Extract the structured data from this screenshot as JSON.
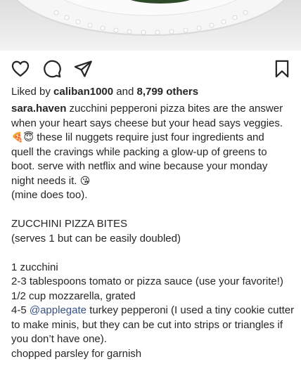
{
  "post": {
    "likes": {
      "prefix": "Liked by",
      "user": "caliban1000",
      "middle": "and",
      "count": "8,799 others"
    },
    "author": "sara.haven",
    "caption_lines": [
      {
        "before": " zucchini pepperoni pizza bites are the answer"
      },
      {
        "before": "when your heart says cheese but your head says veggies."
      },
      {
        "emoji": "🍕😇",
        "before": " these lil nuggets require just four ingredients and"
      },
      {
        "before": "quell the cravings while packing a glow-up of greens to"
      },
      {
        "before": "boot. serve with netflix and wine because your monday"
      },
      {
        "before": "night needs it. ",
        "emoji_after": "😘"
      },
      {
        "before": "(mine does too)."
      },
      {
        "before": ""
      },
      {
        "before": "ZUCCHINI PIZZA BITES"
      },
      {
        "before": "(serves 1 but can be easily doubled)"
      },
      {
        "before": ""
      },
      {
        "before": "1 zucchini"
      },
      {
        "before": "2-3 tablespoons tomato or pizza sauce (use your favorite!)"
      },
      {
        "before": "1/2 cup mozzarella, grated"
      },
      {
        "before": "4-5 ",
        "mention": "@applegate",
        "after": " turkey pepperoni (I used a tiny cookie cutter"
      },
      {
        "before": "to make minis, but they can be cut into strips or triangles if"
      },
      {
        "before": "you don’t have one)."
      },
      {
        "before": "chopped parsley for garnish"
      }
    ]
  },
  "icons": {
    "like": "heart-icon",
    "comment": "comment-bubble-icon",
    "share": "paper-plane-icon",
    "save": "bookmark-icon"
  }
}
